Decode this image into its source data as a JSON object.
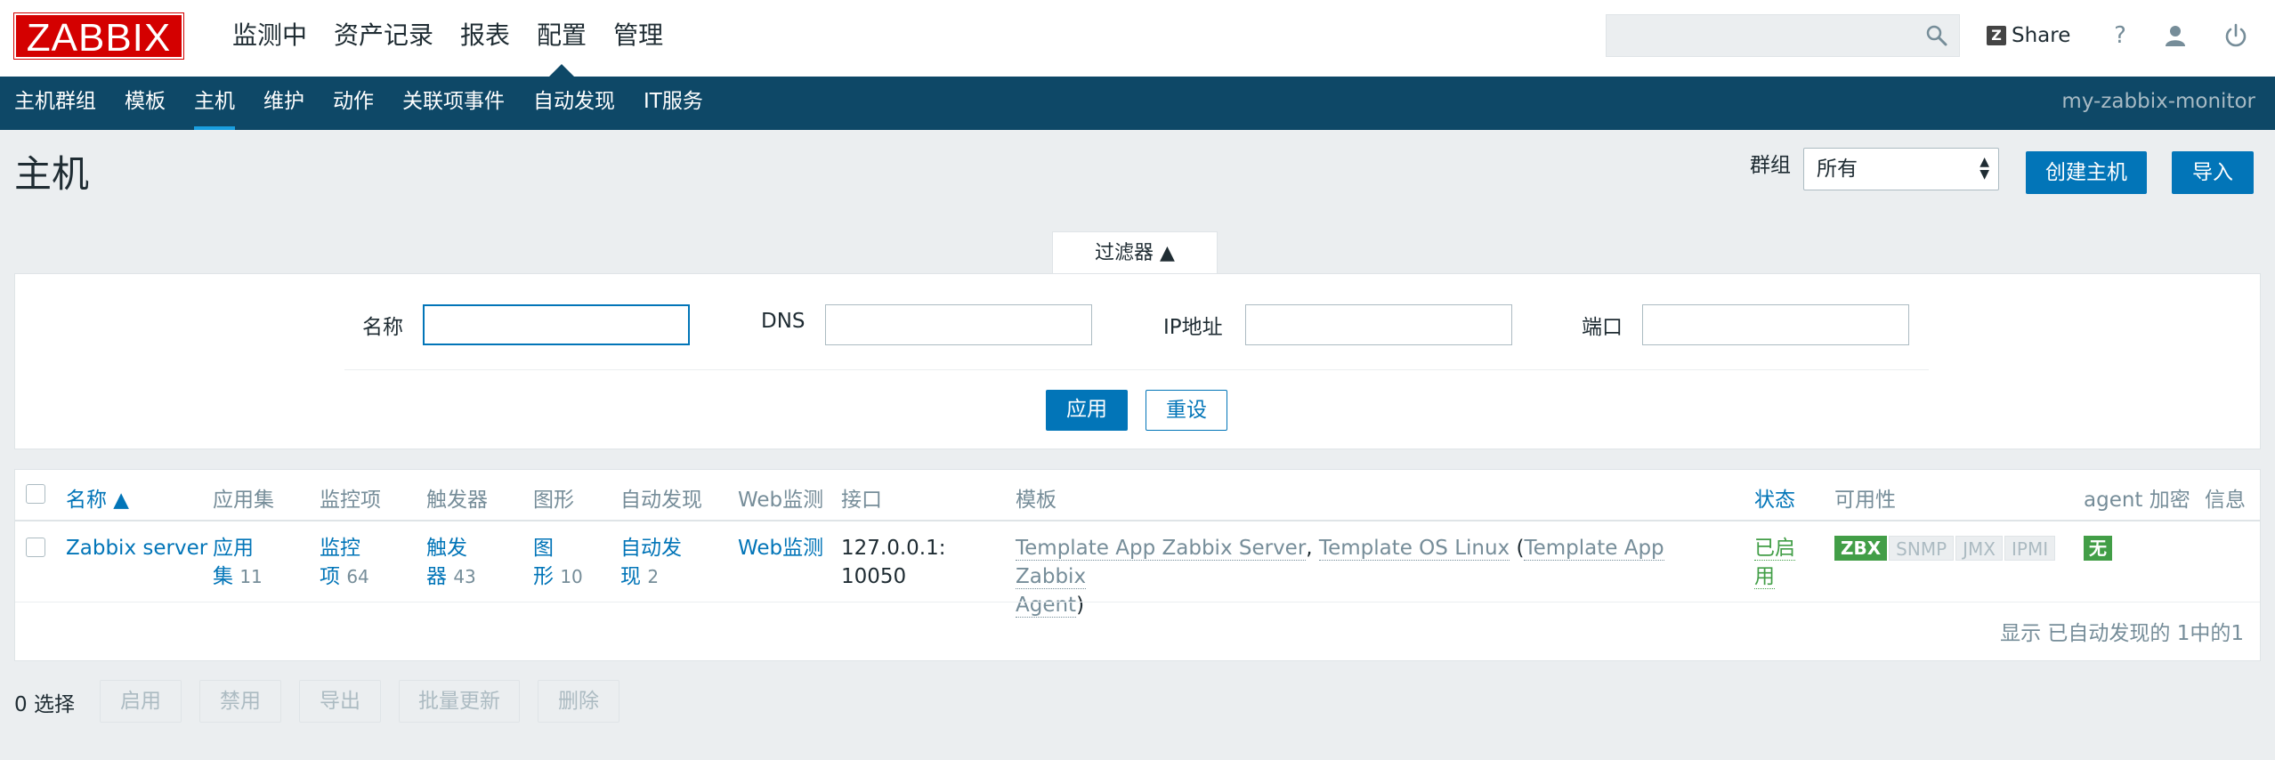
{
  "logo": "ZABBIX",
  "main_menu": [
    "监测中",
    "资产记录",
    "报表",
    "配置",
    "管理"
  ],
  "main_menu_selected": "配置",
  "search": {
    "placeholder": ""
  },
  "share_label": "Share",
  "help_label": "?",
  "sub_menu": [
    "主机群组",
    "模板",
    "主机",
    "维护",
    "动作",
    "关联项事件",
    "自动发现",
    "IT服务"
  ],
  "sub_menu_selected": "主机",
  "server_name": "my-zabbix-monitor",
  "page": {
    "title": "主机",
    "group_label": "群组",
    "group_value": "所有",
    "create_button": "创建主机",
    "import_button": "导入"
  },
  "filter": {
    "tab_label": "过滤器 ▲",
    "name_label": "名称",
    "dns_label": "DNS",
    "ip_label": "IP地址",
    "port_label": "端口",
    "apply_button": "应用",
    "reset_button": "重设"
  },
  "table": {
    "headers": {
      "name": "名称 ▲",
      "apps": "应用集",
      "items": "监控项",
      "triggers": "触发器",
      "graphs": "图形",
      "discovery": "自动发现",
      "web": "Web监测",
      "interface": "接口",
      "templates": "模板",
      "status": "状态",
      "availability": "可用性",
      "encryption": "agent 加密",
      "info": "信息"
    },
    "rows": [
      {
        "name": "Zabbix server",
        "apps_l1": "应用",
        "apps_l2": "集",
        "apps_count": "11",
        "items_l1": "监控",
        "items_l2": "项",
        "items_count": "64",
        "triggers_l1": "触发",
        "triggers_l2": "器",
        "triggers_count": "43",
        "graphs_l1": "图",
        "graphs_l2": "形",
        "graphs_count": "10",
        "discovery_l1": "自动发",
        "discovery_l2": "现",
        "discovery_count": "2",
        "web": "Web监测",
        "interface_l1": "127.0.0.1:",
        "interface_l2": "10050",
        "template_1": "Template App Zabbix Server",
        "template_2": "Template OS Linux",
        "template_3a": "Template App Zabbix",
        "template_3b": "Agent",
        "status_l1": "已启",
        "status_l2": "用",
        "avail": [
          "ZBX",
          "SNMP",
          "JMX",
          "IPMI"
        ],
        "encryption": "无"
      }
    ],
    "footer": "显示 已自动发现的 1中的1"
  },
  "actions": {
    "selected": "0 选择",
    "enable": "启用",
    "disable": "禁用",
    "export": "导出",
    "mass_update": "批量更新",
    "delete": "删除"
  }
}
